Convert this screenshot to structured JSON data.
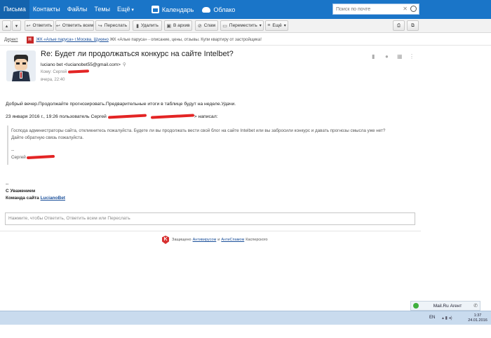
{
  "nav": {
    "items": [
      "Письма",
      "Контакты",
      "Файлы",
      "Темы",
      "Ещё"
    ],
    "calendar": "Календарь",
    "cloud": "Облако",
    "search_placeholder": "Поиск по почте"
  },
  "toolbar": {
    "reply": "Ответить",
    "reply_all": "Ответить всем",
    "forward": "Переслать",
    "delete": "Удалить",
    "archive": "В архив",
    "spam": "Спам",
    "move": "Переместить",
    "more": "Ещё"
  },
  "ad": {
    "label": "Директ",
    "badge": "Н",
    "link_text": "ЖК «Алые паруса» г.Москва, Щукино",
    "text": " ЖК «Алые паруса» - описание, цены, отзывы. Купи квартиру от застройщика!"
  },
  "message": {
    "subject": "Re: Будет ли продолжаться конкурс на сайте Intelbet?",
    "from": "luciano bet <lucianobet55@gmail.com>",
    "to_label": "Кому: Сергей",
    "date": "вчера, 22:40"
  },
  "body": {
    "line1": "Добрый вечер.Продолжайте прогнозировать.Предварительные итоги в таблице будут на неделе.Удачи.",
    "quote_header_start": "23 января 2016 г., 19:26 пользователь Сергей",
    "quote_header_end": "> написал:",
    "quote_line1": "Господа администраторы сайта, откликнитесь пожалуйста. Будете ли вы продолжать вести свой блог на сайте Intelbet или вы забросили конкурс и давать прогнозы смысла уже нет?",
    "quote_line2": "Дайте обратную связь пожалуйста.",
    "quote_dashes": "--",
    "quote_sig": "Сергей",
    "sig_dashes": "--",
    "sig_line1": "С Уважением",
    "sig_line2_prefix": "Команда сайта ",
    "sig_link": "LucianoBet"
  },
  "reply_placeholder": "Нажмите, чтобы Ответить, Ответить всем или Переслать",
  "kaspersky": {
    "badge": "K",
    "prefix": "Защищено",
    "antivirus": "Антивирусом",
    "and": "и",
    "antispam": "АнтиСпамом",
    "suffix": "Касперского"
  },
  "agent": {
    "name": "Mail.Ru Агент"
  },
  "taskbar": {
    "lang": "EN",
    "time": "1:37",
    "date": "24.01.2016"
  }
}
